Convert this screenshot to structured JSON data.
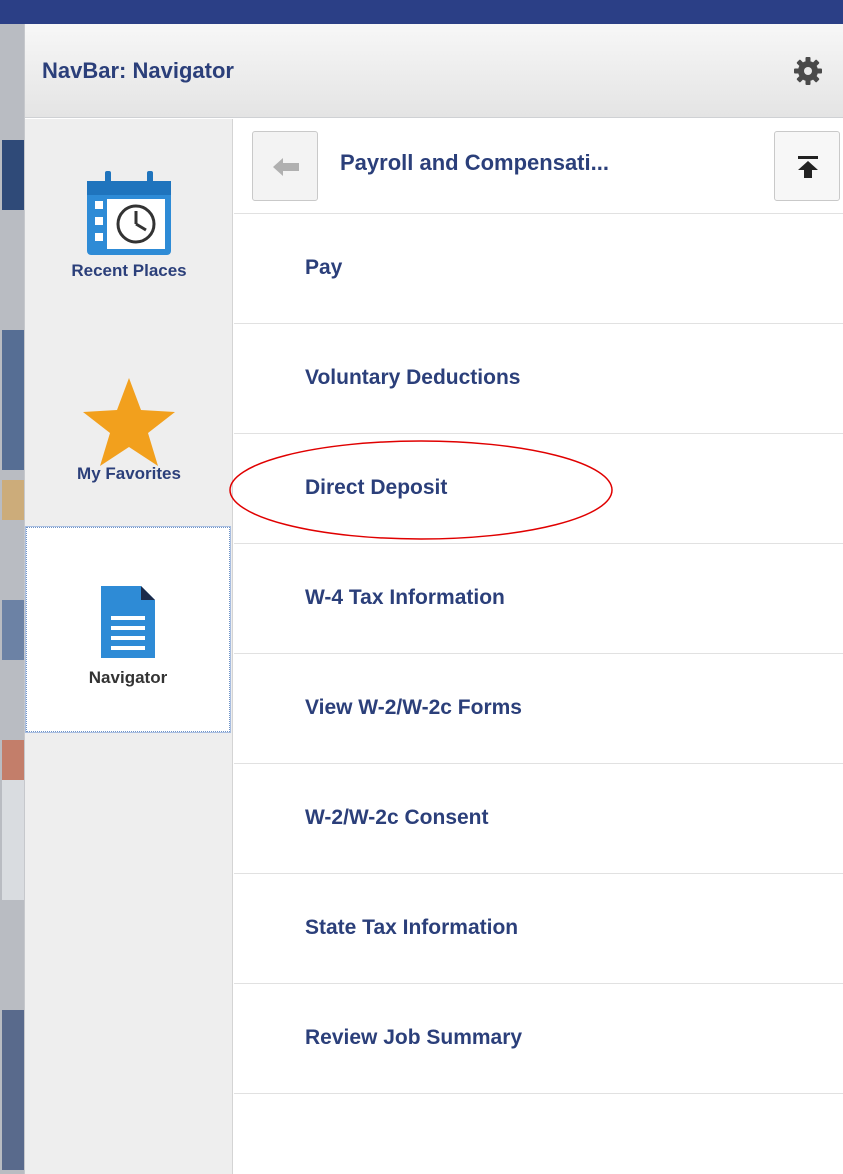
{
  "header": {
    "title": "NavBar: Navigator",
    "settings_icon": "gear-icon"
  },
  "rail": {
    "items": [
      {
        "label": "Recent Places",
        "icon": "calendar-clock-icon"
      },
      {
        "label": "My Favorites",
        "icon": "star-icon"
      },
      {
        "label": "Navigator",
        "icon": "document-icon",
        "selected": true
      }
    ]
  },
  "navigator": {
    "folder_title": "Payroll and Compensati...",
    "back_icon": "back-arrow-icon",
    "top_icon": "navigate-top-icon",
    "items": [
      {
        "label": "Pay"
      },
      {
        "label": "Voluntary Deductions"
      },
      {
        "label": "Direct Deposit",
        "highlighted": true
      },
      {
        "label": "W-4 Tax Information"
      },
      {
        "label": "View W-2/W-2c Forms"
      },
      {
        "label": "W-2/W-2c Consent"
      },
      {
        "label": "State Tax Information"
      },
      {
        "label": "Review Job Summary"
      }
    ]
  },
  "colors": {
    "top_bar": "#2b3f86",
    "link_text": "#2b3f7a",
    "star": "#f2a01d",
    "icon_blue": "#2e8bd6",
    "annotation": "#e00000"
  }
}
